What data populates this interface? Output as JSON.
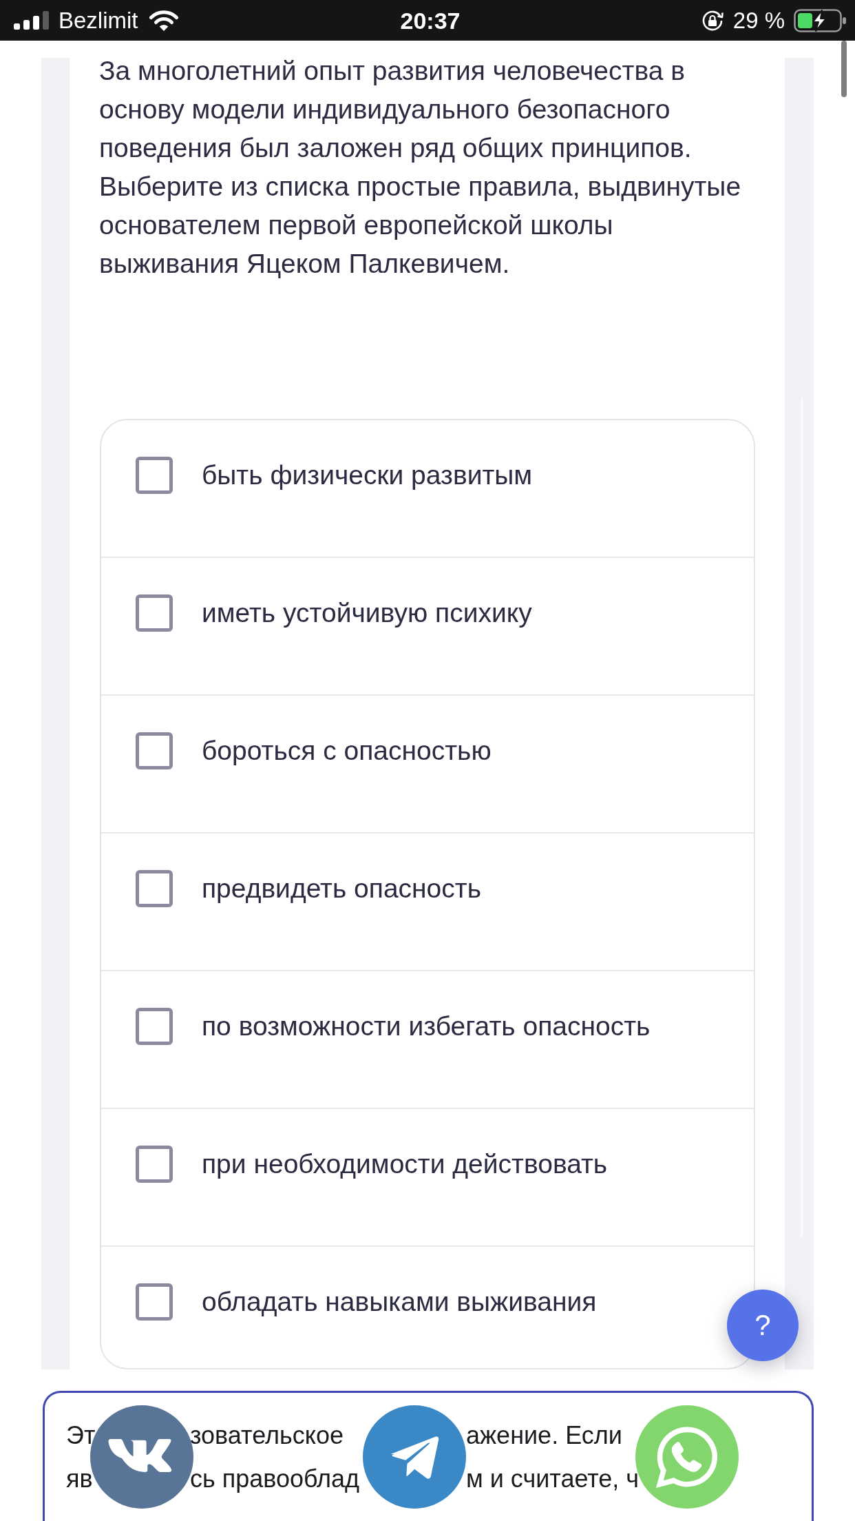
{
  "status_bar": {
    "carrier": "Bezlimit",
    "time": "20:37",
    "battery": "29 %"
  },
  "question": {
    "text": "За многолетний опыт развития человечества в основу модели индивидуального безопасного поведения был заложен ряд общих принципов. Выберите из списка простые правила, выдвинутые основателем первой европейской школы выживания Яцеком Палкевичем."
  },
  "options": [
    {
      "label": "быть физически развитым",
      "checked": false
    },
    {
      "label": "иметь устойчивую психику",
      "checked": false
    },
    {
      "label": "бороться с опасностью",
      "checked": false
    },
    {
      "label": "предвидеть опасность",
      "checked": false
    },
    {
      "label": "по возможности избегать опасность",
      "checked": false
    },
    {
      "label": "при необходимости действовать",
      "checked": false
    },
    {
      "label": "обладать навыками выживания",
      "checked": false
    }
  ],
  "help_button": {
    "label": "?"
  },
  "notice": {
    "lines": [
      [
        "Эт",
        "зовательское",
        "ажение. Если"
      ],
      [
        "яв",
        "сь правооблад",
        "м и считаете, ч"
      ]
    ]
  },
  "share_buttons": [
    {
      "kind": "vk"
    },
    {
      "kind": "telegram"
    },
    {
      "kind": "whatsapp"
    }
  ]
}
